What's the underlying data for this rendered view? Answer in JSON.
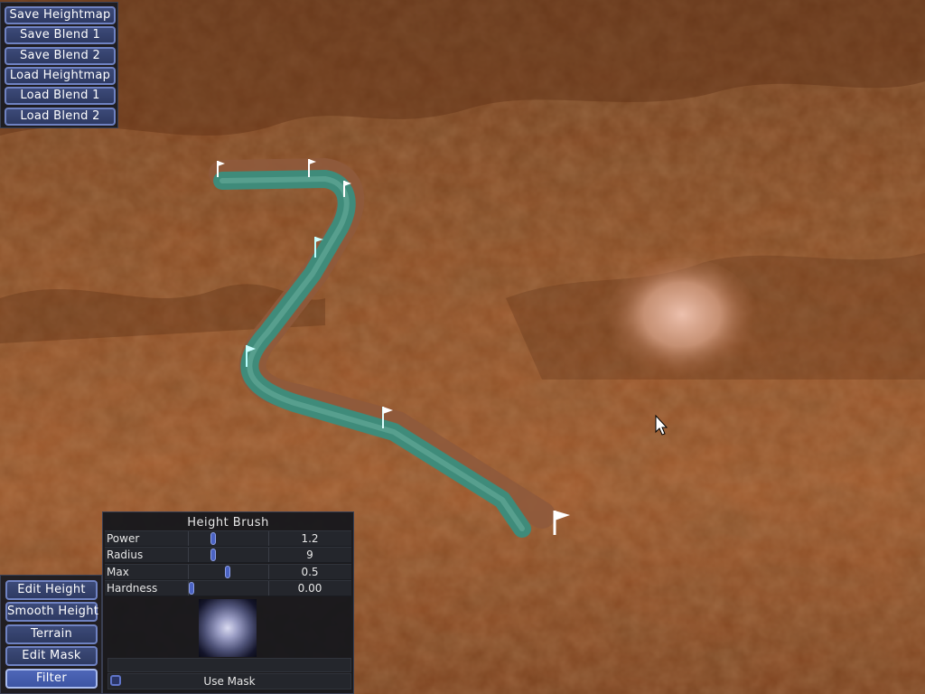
{
  "file_panel": {
    "buttons": [
      "Save Heightmap",
      "Save Blend 1",
      "Save Blend 2",
      "Load Heightmap",
      "Load Blend 1",
      "Load Blend 2"
    ]
  },
  "mode_panel": {
    "buttons": [
      "Edit Height",
      "Smooth Height",
      "Terrain",
      "Edit Mask",
      "Filter"
    ],
    "active": "Filter"
  },
  "brush_panel": {
    "title": "Height Brush",
    "sliders": [
      {
        "label": "Power",
        "value": "1.2",
        "fraction": 0.29
      },
      {
        "label": "Radius",
        "value": "9",
        "fraction": 0.29
      },
      {
        "label": "Max",
        "value": "0.5",
        "fraction": 0.49
      },
      {
        "label": "Hardness",
        "value": "0.00",
        "fraction": 0.0
      }
    ],
    "use_mask_label": "Use Mask",
    "use_mask_checked": false
  },
  "scene": {
    "terrain_color": "#8a4a22",
    "road_color": "#3f8b7a",
    "flag_color": "#ffffff",
    "flag_count": 7,
    "cursor_icon": "arrow-cursor-icon"
  }
}
